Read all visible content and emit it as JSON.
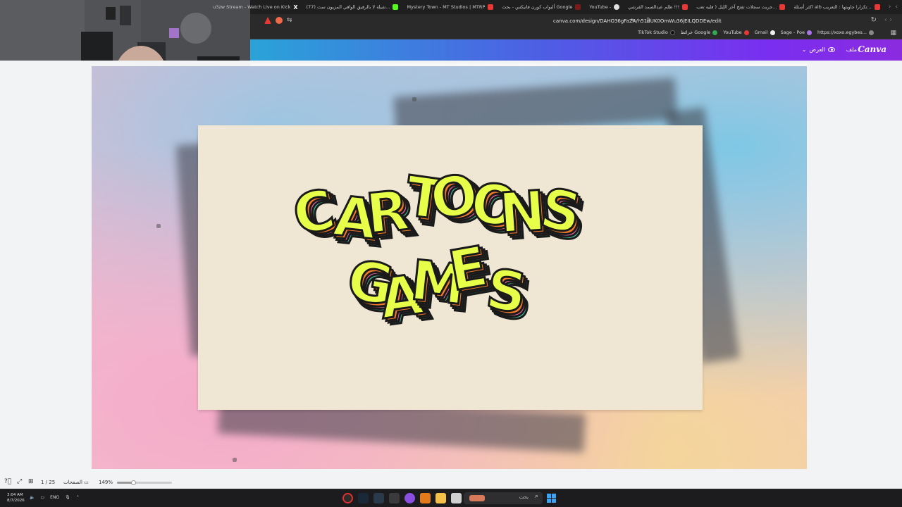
{
  "browser": {
    "tabs": [
      {
        "label": "اكثر أسئلة alb تكرارا جاوبتها : التعريب..."
      },
      {
        "label": "جربت سجلات تفتح آخر الليل ( فليه تعب..."
      },
      {
        "label": "ظلم عبدالصمد القرشي !!!"
      },
      {
        "label": "YouTube -"
      },
      {
        "label": "ألبواب كورن فانيكس - بحث Google"
      },
      {
        "label": "Mystery Town - MT Studios | MTRP"
      },
      {
        "label": "(77) شيلة لا بالرفيق الوافي المزيون ست..."
      },
      {
        "label": "u3zw Stream - Watch Live on Kick"
      }
    ],
    "address": "canva.com/design/DAHO36gFaZA/h51dUK0OmWu36jEILQDDEw/edit",
    "bookmarks": [
      {
        "label": "https://xoxo.egybes..."
      },
      {
        "label": "Sage - Poe"
      },
      {
        "label": "Gmail"
      },
      {
        "label": "YouTube"
      },
      {
        "label": "خرائط Google"
      },
      {
        "label": "TikTok Studio"
      }
    ]
  },
  "canva": {
    "logo": "Canva",
    "file_menu": "ملف",
    "view_label": "العرض"
  },
  "design": {
    "line1": "CARTOONS",
    "line2": "GAMES",
    "colors": {
      "card": "#efe6d4",
      "letter_fill": "#e8ff4a",
      "stripe1": "#3fbf9a",
      "stripe2": "#f06aa8",
      "stripe3": "#f47a2a",
      "outline": "#1a1a1a"
    }
  },
  "statusbar": {
    "zoom": "149%",
    "zoom_level": 0.3,
    "pages_label": "الصفحات",
    "page_counter": "1 / 25"
  },
  "taskbar": {
    "time": "3:04 AM",
    "date": "8/7/2026",
    "lang": "ENG",
    "search_label": "بحث"
  }
}
